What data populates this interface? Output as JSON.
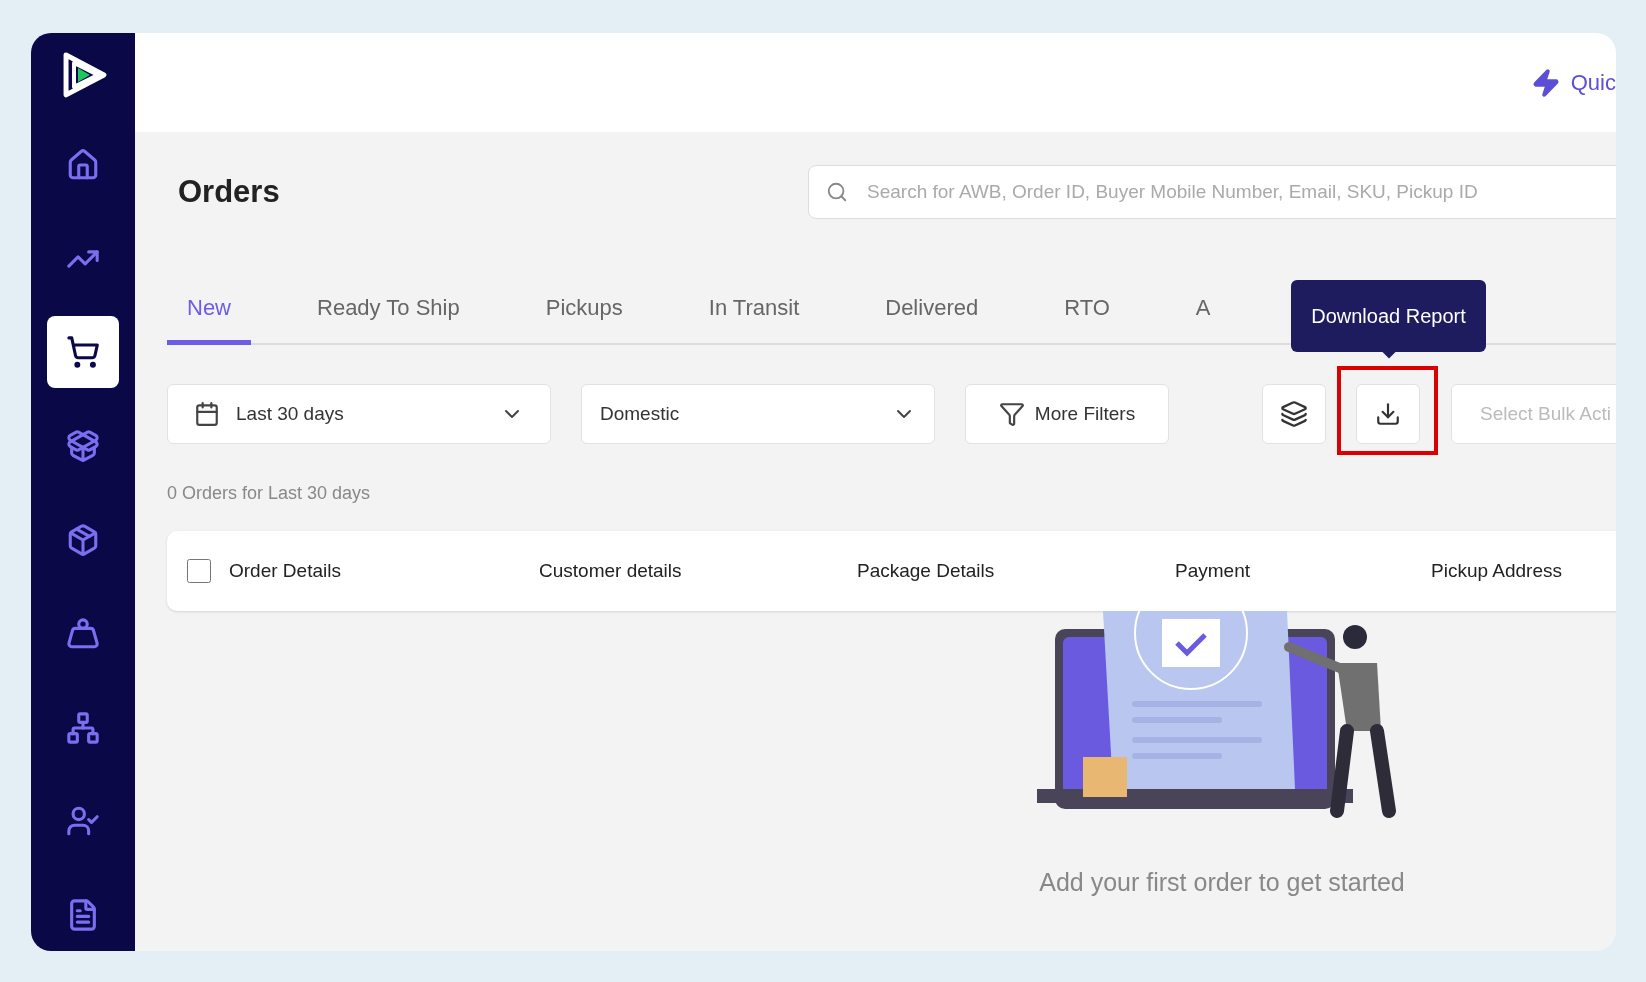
{
  "sidebar": {
    "items": [
      {
        "kind": "home",
        "selected": false
      },
      {
        "kind": "chart",
        "selected": false
      },
      {
        "kind": "cart",
        "selected": true
      },
      {
        "kind": "return",
        "selected": false
      },
      {
        "kind": "unbox",
        "selected": false
      },
      {
        "kind": "weight",
        "selected": false
      },
      {
        "kind": "network",
        "selected": false
      },
      {
        "kind": "user",
        "selected": false
      },
      {
        "kind": "doc",
        "selected": false
      }
    ]
  },
  "header": {
    "quick_label": "Quic"
  },
  "page": {
    "title": "Orders",
    "search": {
      "placeholder": "Search for AWB, Order ID, Buyer Mobile Number, Email, SKU, Pickup ID"
    }
  },
  "tabs": [
    {
      "label": "New",
      "selected": true
    },
    {
      "label": "Ready To Ship",
      "selected": false
    },
    {
      "label": "Pickups",
      "selected": false
    },
    {
      "label": "In Transit",
      "selected": false
    },
    {
      "label": "Delivered",
      "selected": false
    },
    {
      "label": "RTO",
      "selected": false
    },
    {
      "label": "A",
      "selected": false
    }
  ],
  "filters": {
    "date": "Last 30 days",
    "region": "Domestic",
    "more": "More Filters",
    "bulk_action": {
      "placeholder": "Select Bulk Acti"
    }
  },
  "download": {
    "tooltip": "Download Report",
    "highlighted": true
  },
  "summary": "0 Orders for Last 30 days",
  "table": {
    "select_all": {
      "checked": false
    },
    "columns": [
      "Order Details",
      "Customer details",
      "Package Details",
      "Payment",
      "Pickup Address"
    ]
  },
  "empty_state": {
    "message": "Add your first order to get started"
  }
}
